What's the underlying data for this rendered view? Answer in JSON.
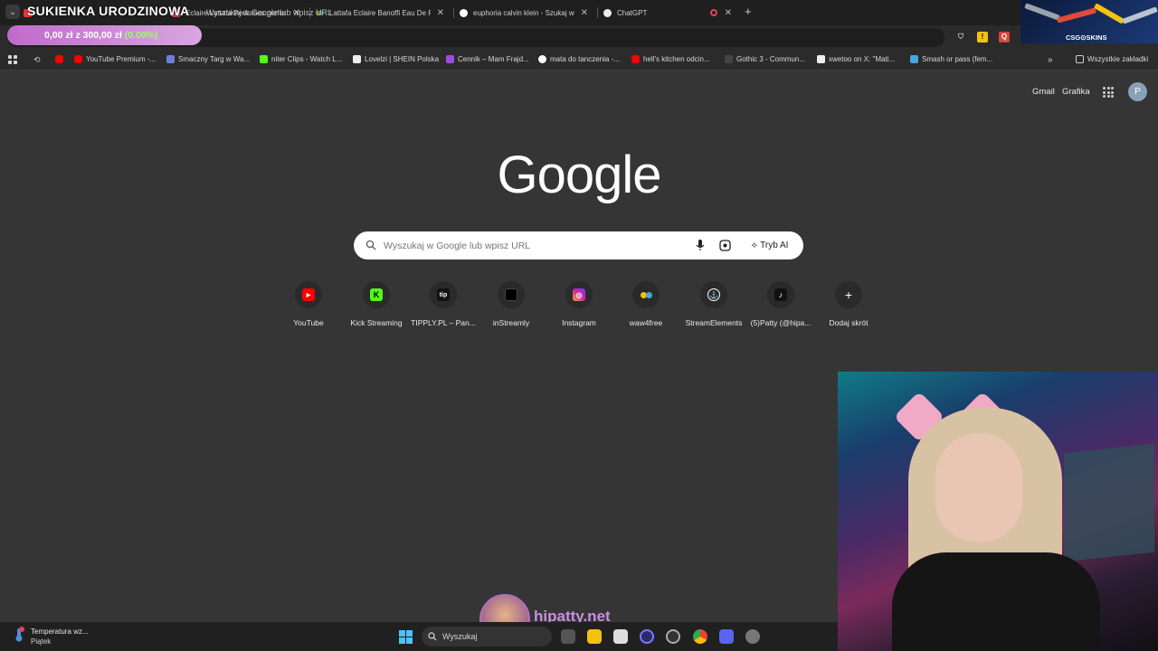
{
  "tabs": [
    {
      "title": "SUKIENKA URODZINOWA",
      "fav_color": "#e33"
    },
    {
      "title": "Eclaire Lattafa Perfumes perfum",
      "fav_color": "#c44"
    },
    {
      "title": "Lattafa Eclaire Banoffi Eau De P",
      "fav_color": "#ddd"
    },
    {
      "title": "euphoria calvin klein - Szukaj w",
      "fav_color": "#4285f4"
    },
    {
      "title": "ChatGPT",
      "fav_color": "#eee"
    }
  ],
  "goal": {
    "title": "SUKIENKA URODZINOWA",
    "amount": "0,00 zł",
    "sep": "z",
    "target": "300,00 zł",
    "percent": "(0.00%)",
    "progress": 0
  },
  "omnibox": {
    "text": "Wyszukaj w Google lub wpisz URL"
  },
  "csgo": {
    "label": "CSG⊙SKINS"
  },
  "bookmarks": [
    {
      "label": "",
      "color": "#ff0000"
    },
    {
      "label": "YouTube Premium -...",
      "color": "#ff0000"
    },
    {
      "label": "Smaczny Targ w Wa...",
      "color": "#6a7fd6"
    },
    {
      "label": "niter Clips - Watch L...",
      "color": "#53fc18"
    },
    {
      "label": "Lovelzi | SHEIN Polska",
      "color": "#222"
    },
    {
      "label": "Cennik – Mam Frajd...",
      "color": "#9a4be0"
    },
    {
      "label": "mata do tanczenia -...",
      "color": "#4285f4"
    },
    {
      "label": "hell's kitchen odcin...",
      "color": "#ff0000"
    },
    {
      "label": "Gothic 3 - Commun...",
      "color": "#444"
    },
    {
      "label": "xwetoo on X: \"Mati...",
      "color": "#111"
    },
    {
      "label": "Smash or pass (fem...",
      "color": "#4aa3df"
    }
  ],
  "all_bookmarks": "Wszystkie zakładki",
  "header": {
    "gmail": "Gmail",
    "images": "Grafika",
    "avatar_letter": "P"
  },
  "logo": "Google",
  "search": {
    "placeholder": "Wyszukaj w Google lub wpisz URL",
    "ai_mode": "Tryb AI"
  },
  "shortcuts": [
    {
      "label": "YouTube",
      "color": "#ff0000",
      "glyph": "▶"
    },
    {
      "label": "Kick Streaming",
      "color": "#53fc18",
      "glyph": "K"
    },
    {
      "label": "TIPPLY.PL – Pan...",
      "color": "#111111",
      "glyph": "tip"
    },
    {
      "label": "inStreamly",
      "color": "#111111",
      "glyph": "■"
    },
    {
      "label": "Instagram",
      "color": "#d6249f",
      "glyph": "◎"
    },
    {
      "label": "waw4free",
      "color": "#2b2b2b",
      "glyph": "●"
    },
    {
      "label": "StreamElements",
      "color": "#2b2b2b",
      "glyph": "⚓"
    },
    {
      "label": "(5)Patty (@hipa...",
      "color": "#111111",
      "glyph": "♪"
    },
    {
      "label": "Dodaj skrót",
      "color": "#2a2a2a",
      "glyph": "+"
    }
  ],
  "watermark": {
    "text": "hipatty.net"
  },
  "taskbar": {
    "weather_title": "Temperatura wz...",
    "weather_sub": "Piątek",
    "search_label": "Wyszukaj"
  }
}
